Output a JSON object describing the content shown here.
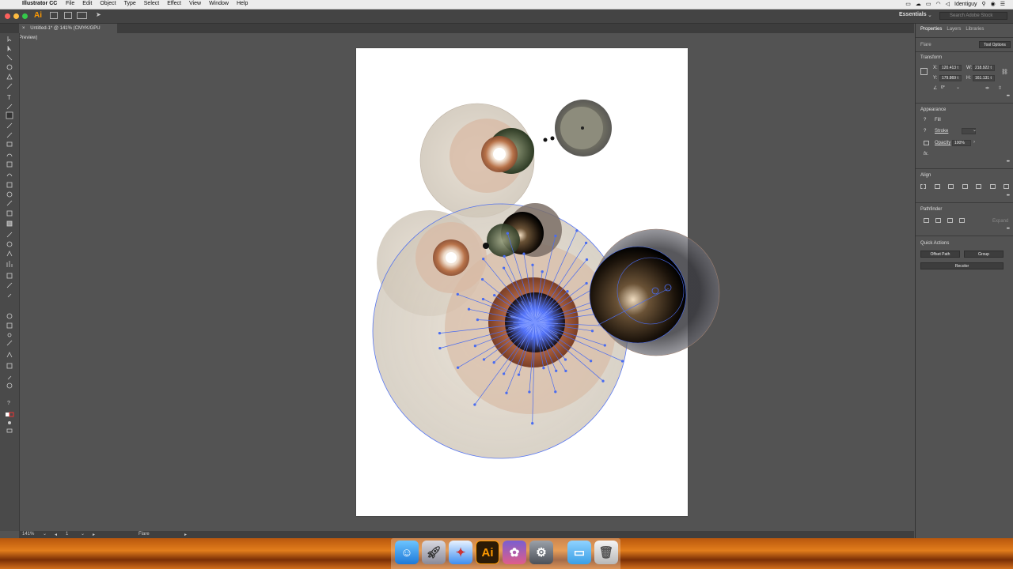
{
  "menubar": {
    "app_name": "Illustrator CC",
    "items": [
      "File",
      "Edit",
      "Object",
      "Type",
      "Select",
      "Effect",
      "View",
      "Window",
      "Help"
    ],
    "user": "Identiguy"
  },
  "appbar": {
    "logo": "Ai",
    "workspace": "Essentials",
    "stock_placeholder": "Search Adobe Stock"
  },
  "document_tab": {
    "title": "Untitled-1* @ 141% (CMYK/GPU Preview)",
    "close": "×"
  },
  "statusbar": {
    "zoom": "141%",
    "artboard": "1",
    "tool": "Flare"
  },
  "panel": {
    "tabs": [
      "Properties",
      "Layers",
      "Libraries"
    ],
    "selection": "Flare",
    "tool_options": "Tool Options",
    "transform": {
      "title": "Transform",
      "x_label": "X:",
      "x": "120.413 t",
      "y_label": "Y:",
      "y": "179.869 t",
      "w_label": "W:",
      "w": "218.922 t",
      "h_label": "H:",
      "h": "161.131 t",
      "angle": "0°"
    },
    "appearance": {
      "title": "Appearance",
      "fill": "Fill",
      "stroke": "Stroke",
      "opacity_label": "Opacity",
      "opacity": "100%",
      "fx": "fx."
    },
    "align": {
      "title": "Align"
    },
    "pathfinder": {
      "title": "Pathfinder",
      "expand": "Expand"
    },
    "quick_actions": {
      "title": "Quick Actions",
      "offset_path": "Offset Path",
      "group": "Group",
      "recolor": "Recolor"
    }
  },
  "dock": {
    "apps": [
      "finder-icon",
      "launchpad-icon",
      "safari-icon",
      "illustrator-icon",
      "photos-icon",
      "system-preferences-icon",
      "downloads-folder-icon",
      "trash-icon"
    ],
    "illustrator_label": "Ai"
  },
  "colors": {
    "selection_blue": "#4a6cf0",
    "accent_orange": "#ff9a00"
  }
}
